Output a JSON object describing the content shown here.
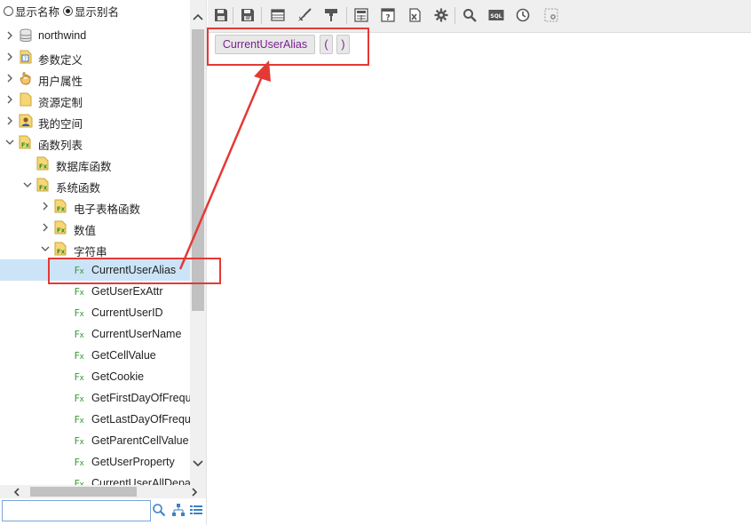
{
  "display_mode": {
    "options": [
      {
        "label": "显示名称",
        "checked": false
      },
      {
        "label": "显示别名",
        "checked": true
      }
    ]
  },
  "tree": {
    "items": [
      {
        "label": "northwind",
        "icon": "database-icon",
        "expanded": false
      },
      {
        "label": "参数定义",
        "icon": "parameter-icon",
        "expanded": false
      },
      {
        "label": "用户属性",
        "icon": "hand-icon",
        "expanded": false
      },
      {
        "label": "资源定制",
        "icon": "folder-icon",
        "expanded": false
      },
      {
        "label": "我的空间",
        "icon": "user-icon",
        "expanded": false
      },
      {
        "label": "函数列表",
        "icon": "function-folder-icon",
        "expanded": true
      },
      {
        "label": "数据库函数",
        "icon": "function-folder-icon"
      },
      {
        "label": "系统函数",
        "icon": "function-folder-icon",
        "expanded": true
      },
      {
        "label": "电子表格函数",
        "icon": "function-folder-icon",
        "expanded": false
      },
      {
        "label": "数值",
        "icon": "function-folder-icon",
        "expanded": false
      },
      {
        "label": "字符串",
        "icon": "function-folder-icon",
        "expanded": true
      },
      {
        "label": "CurrentUserAlias",
        "icon": "fx-icon",
        "selected": true
      },
      {
        "label": "GetUserExAttr",
        "icon": "fx-icon"
      },
      {
        "label": "CurrentUserID",
        "icon": "fx-icon"
      },
      {
        "label": "CurrentUserName",
        "icon": "fx-icon"
      },
      {
        "label": "GetCellValue",
        "icon": "fx-icon"
      },
      {
        "label": "GetCookie",
        "icon": "fx-icon"
      },
      {
        "label": "GetFirstDayOfFrequ",
        "icon": "fx-icon"
      },
      {
        "label": "GetLastDayOfFrequ",
        "icon": "fx-icon"
      },
      {
        "label": "GetParentCellValue",
        "icon": "fx-icon"
      },
      {
        "label": "GetUserProperty",
        "icon": "fx-icon"
      },
      {
        "label": "CurrentUserAllDepa",
        "icon": "fx-icon"
      }
    ]
  },
  "search": {
    "value": "",
    "placeholder": ""
  },
  "toolbar": {
    "buttons": [
      "save-icon",
      "save-as-icon",
      "table-icon",
      "brush-icon",
      "format-icon",
      "layout-icon",
      "help-doc-icon",
      "excel-icon",
      "gear-icon",
      "search-icon",
      "sql-icon",
      "clock-icon",
      "settings-grid-icon"
    ],
    "sql_label": "SQL"
  },
  "expression": {
    "tokens": [
      "CurrentUserAlias",
      "(",
      ")"
    ]
  },
  "colors": {
    "token_text": "#7b1f8f",
    "highlight": "#e53935",
    "selection": "#cce4f7",
    "fx_green": "#3a9a3a"
  }
}
